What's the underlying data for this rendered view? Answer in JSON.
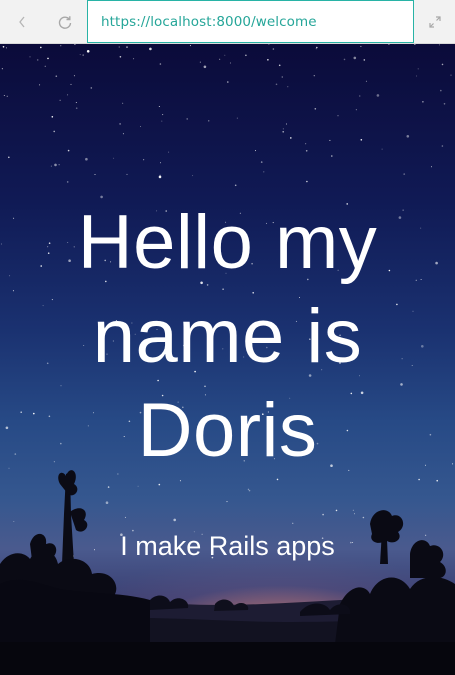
{
  "browser": {
    "url": "https://localhost:8000/welcome",
    "back_icon": "chevron-left-icon",
    "reload_icon": "reload-icon",
    "expand_icon": "expand-icon",
    "url_color": "#26a699",
    "url_border_color": "#28b3a6"
  },
  "hero": {
    "title_line_1": "Hello my",
    "title_line_2": "name is",
    "title_line_3": "Doris",
    "subtitle": "I make Rails apps",
    "background": "night-sky-with-stars-and-tree-silhouettes"
  }
}
